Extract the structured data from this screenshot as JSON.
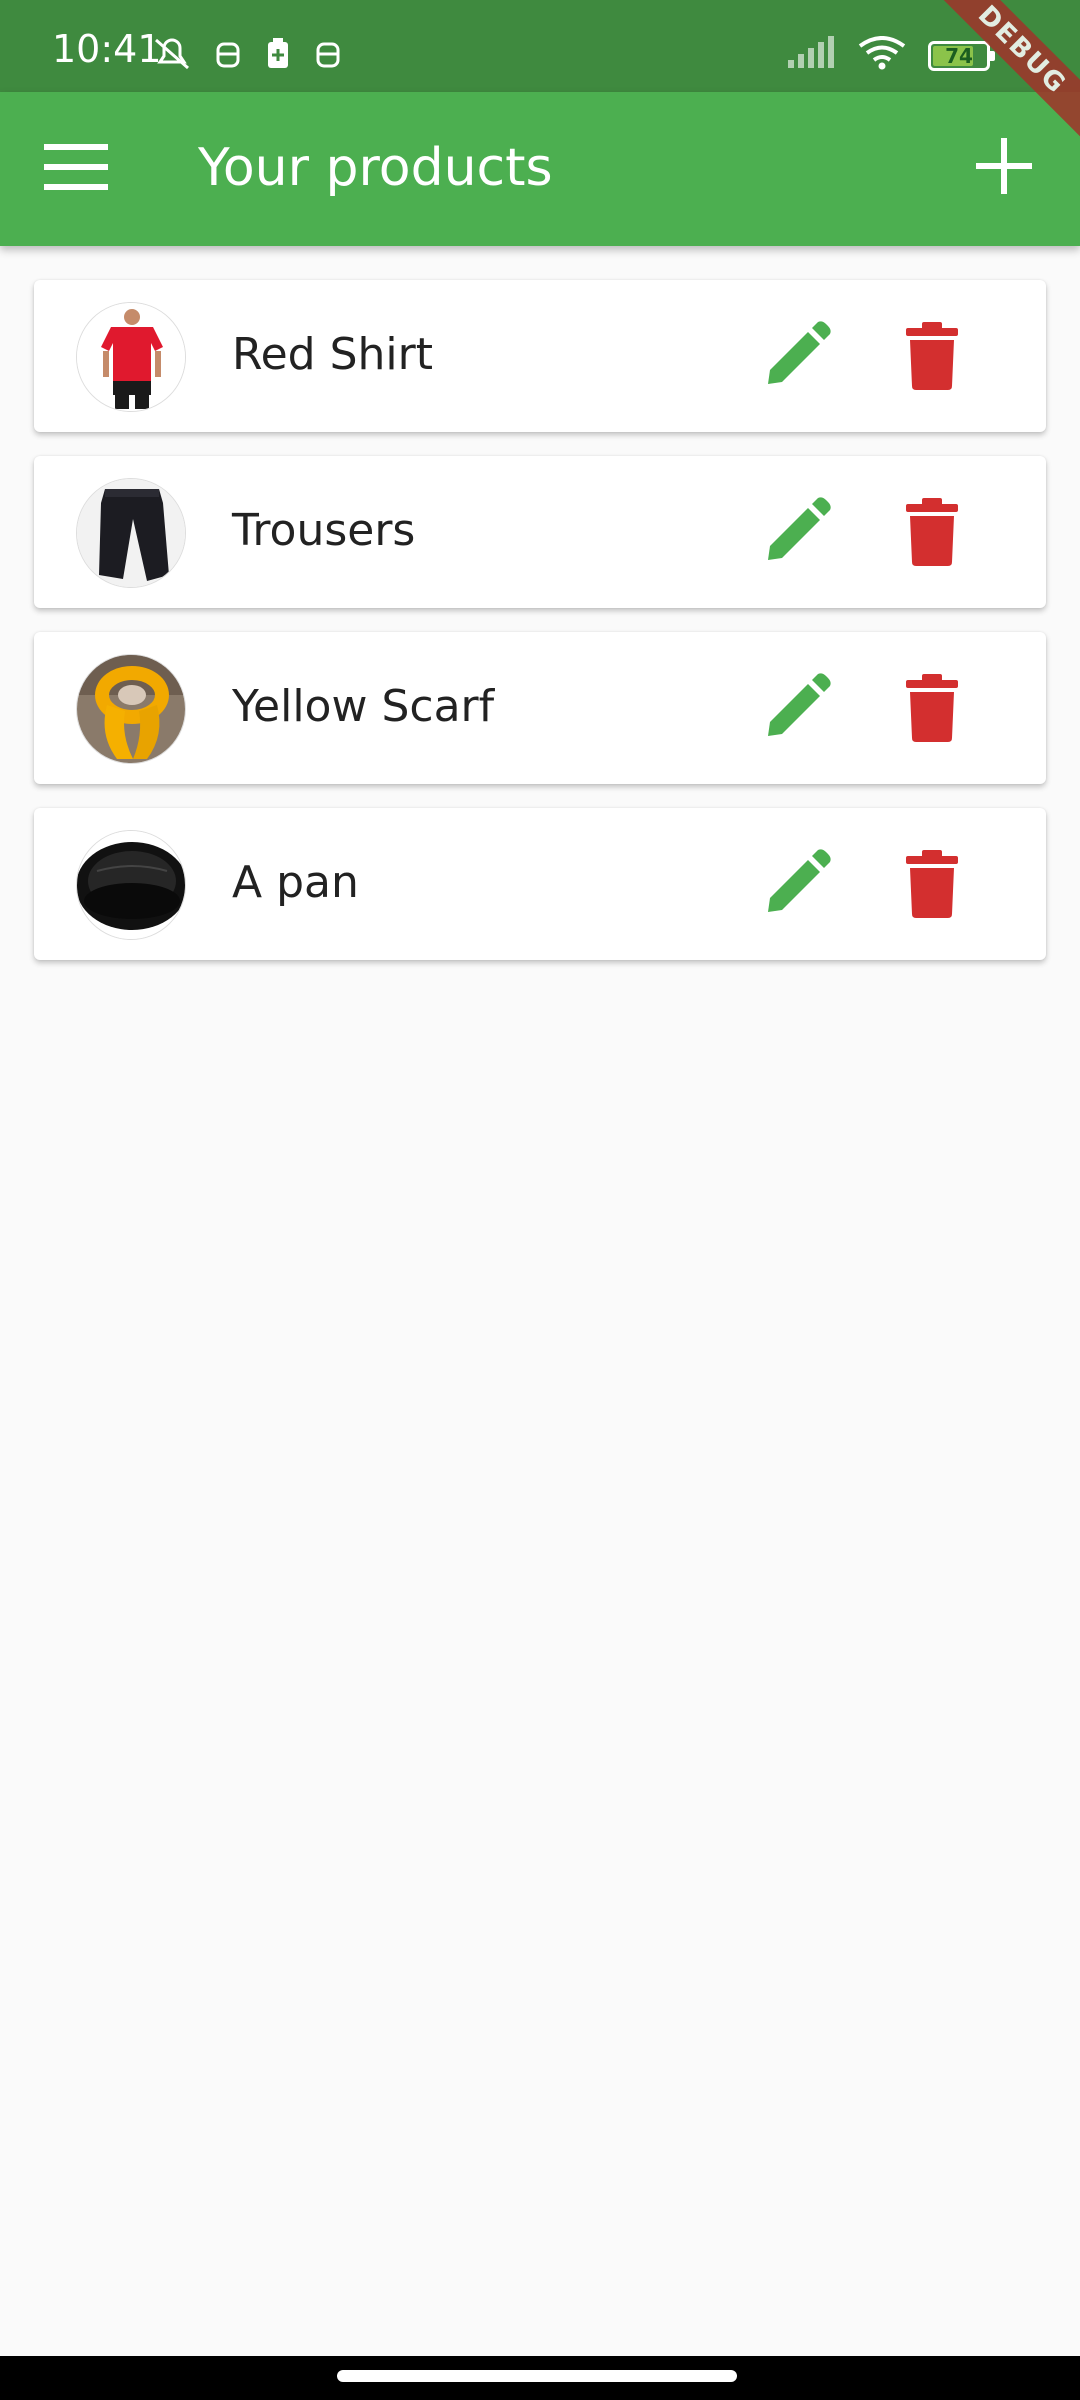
{
  "status_bar": {
    "time": "10:41",
    "battery_level": "74",
    "icons_left": [
      "alarm-off-icon",
      "android-icon",
      "battery-saver-icon",
      "android-icon"
    ],
    "icons_right": [
      "signal-icon",
      "wifi-icon",
      "battery-icon"
    ]
  },
  "app_bar": {
    "title": "Your products",
    "menu_icon": "menu-icon",
    "add_icon": "add-icon",
    "color": "#4caf50"
  },
  "debug_banner": "DEBUG",
  "products": [
    {
      "name": "Red Shirt",
      "image": "red-shirt-image"
    },
    {
      "name": "Trousers",
      "image": "trousers-image"
    },
    {
      "name": "Yellow Scarf",
      "image": "yellow-scarf-image"
    },
    {
      "name": "A pan",
      "image": "pan-image"
    }
  ],
  "actions": {
    "edit_icon": "pencil-icon",
    "edit_color": "#4caf50",
    "delete_icon": "trash-icon",
    "delete_color": "#d32f2f"
  }
}
